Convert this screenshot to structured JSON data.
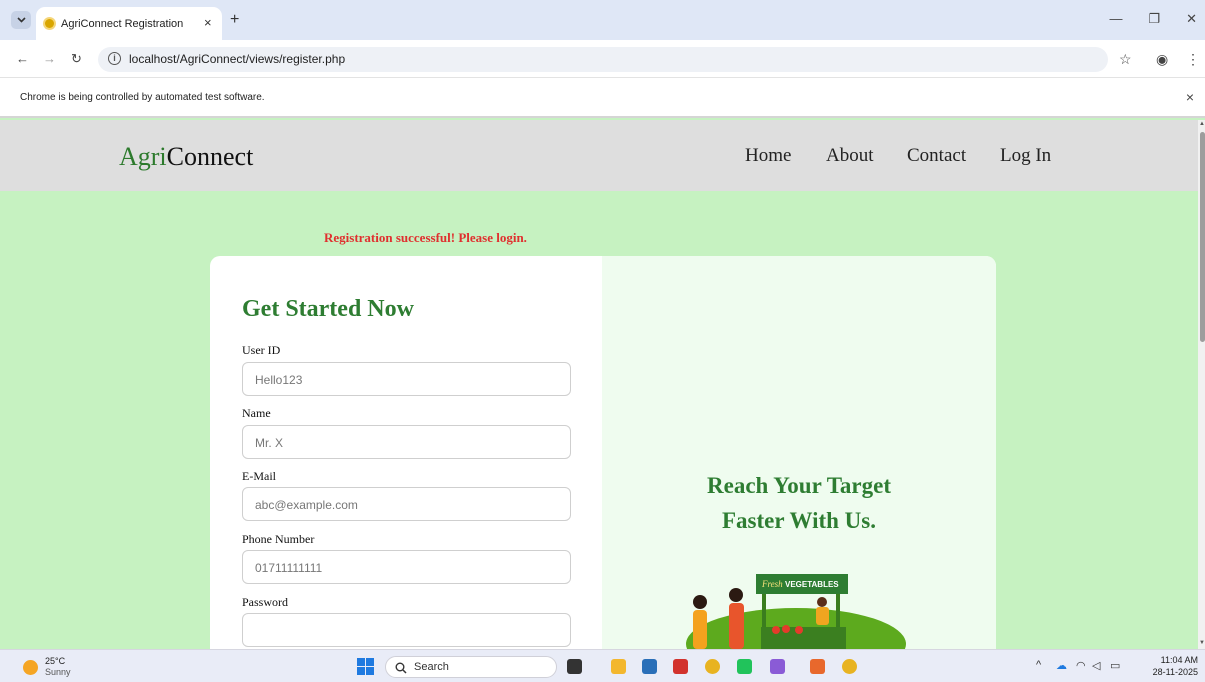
{
  "browser": {
    "tab_title": "AgriConnect Registration",
    "tab_close": "×",
    "new_tab": "+",
    "url": "localhost/AgriConnect/views/register.php",
    "infobar_message": "Chrome is being controlled by automated test software.",
    "infobar_close": "×"
  },
  "site": {
    "logo_part1": "Agri",
    "logo_part2": "Connect",
    "nav": [
      "Home",
      "About",
      "Contact",
      "Log In"
    ]
  },
  "page": {
    "success_message": "Registration successful! Please login.",
    "form_title": "Get Started Now",
    "fields": [
      {
        "label": "User ID",
        "placeholder": "Hello123"
      },
      {
        "label": "Name",
        "placeholder": "Mr. X"
      },
      {
        "label": "E-Mail",
        "placeholder": "abc@example.com"
      },
      {
        "label": "Phone Number",
        "placeholder": "01711111111"
      },
      {
        "label": "Password",
        "placeholder": ""
      }
    ],
    "tagline_line1": "Reach Your Target",
    "tagline_line2": "Faster With Us.",
    "illustration_sign_script": "Fresh",
    "illustration_sign_text": "VEGETABLES"
  },
  "taskbar": {
    "temperature": "25°C",
    "condition": "Sunny",
    "search_label": "Search",
    "time": "11:04 AM",
    "date": "28-11-2025"
  },
  "colors": {
    "page_bg": "#c6f2c1",
    "brand_green": "#2e7d32",
    "success_red": "#e0302f",
    "header_bg": "#dedede"
  }
}
